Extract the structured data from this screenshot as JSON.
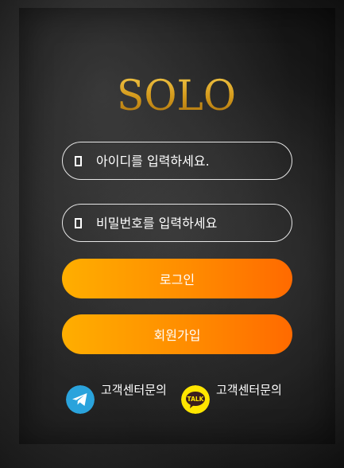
{
  "brand": {
    "logo_text": "SOLO",
    "accent_color": "#d4a017"
  },
  "login_form": {
    "id_field": {
      "placeholder": "아이디를 입력하세요.",
      "value": "",
      "icon": "user-icon"
    },
    "password_field": {
      "placeholder": "비밀번호를 입력하세요",
      "value": "",
      "icon": "lock-icon"
    },
    "login_button": "로그인",
    "signup_button": "회원가입",
    "button_gradient": [
      "#ffae00",
      "#ff6a00"
    ]
  },
  "support": [
    {
      "label": "고객센터문의",
      "icon": "telegram-icon",
      "color": "#2aa3dc"
    },
    {
      "label": "고객센터문의",
      "icon": "kakaotalk-icon",
      "color": "#ffe600"
    }
  ]
}
